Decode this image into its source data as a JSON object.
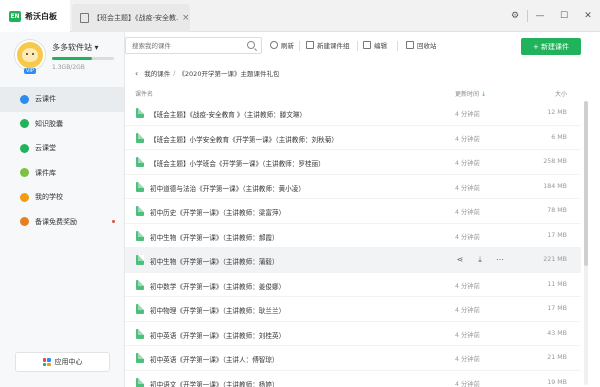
{
  "window": {
    "app_name": "希沃白板",
    "app_logo_text": "EN",
    "doc_tab_title": "【班会主题】《战疫-安全教...",
    "doc_tab_close": "×",
    "controls": [
      "⚙",
      "—",
      "☐",
      "✕"
    ]
  },
  "sidebar": {
    "user_name": "多多软件站 ▾",
    "vip_badge": "VIP",
    "storage_text": "1.3GB/2GB",
    "storage_fraction": 0.65,
    "items": [
      {
        "label": "云课件",
        "icon": "cloud-icon",
        "color": "#2d8cf0",
        "active": true
      },
      {
        "label": "知识胶囊",
        "icon": "capsule-icon",
        "color": "#21b35b",
        "active": false
      },
      {
        "label": "云课堂",
        "icon": "classroom-icon",
        "color": "#21b35b",
        "active": false
      },
      {
        "label": "课件库",
        "icon": "library-icon",
        "color": "#7cc142",
        "active": false
      },
      {
        "label": "我的学校",
        "icon": "school-icon",
        "color": "#f39c12",
        "active": false
      },
      {
        "label": "备课免费奖励",
        "icon": "gift-icon",
        "color": "#e67e22",
        "active": false
      }
    ],
    "app_center_label": "应用中心"
  },
  "toolbar": {
    "search_placeholder": "搜索我的课件",
    "refresh": "刷新",
    "new_group": "新建课件组",
    "edit": "编辑",
    "recycle": "回收站",
    "new_courseware": "+ 新建课件"
  },
  "breadcrumb": {
    "back": "‹",
    "root": "我的课件",
    "sep": "/",
    "current": "《2020开学第一课》主题课件礼包"
  },
  "table": {
    "col_name": "课件名",
    "col_time": "更新时间",
    "col_time_sort": "↓",
    "col_size": "大小",
    "rows": [
      {
        "name": "【班会主题】《战疫-安全教育 》（主讲教师：滕文琳）",
        "time": "4 分钟前",
        "size": "12 MB"
      },
      {
        "name": "【班会主题】小学安全教育《开学第一课》（主讲教师：刘秋菊）",
        "time": "4 分钟前",
        "size": "6 MB"
      },
      {
        "name": "【班会主题】小学班会《开学第一课》（主讲教师：罗桂丽）",
        "time": "4 分钟前",
        "size": "258 MB"
      },
      {
        "name": "初中道德与法治《开学第一课》（主讲教师：黄小凌）",
        "time": "4 分钟前",
        "size": "184 MB"
      },
      {
        "name": "初中历史《开学第一课》（主讲教师：梁富萍）",
        "time": "4 分钟前",
        "size": "78 MB"
      },
      {
        "name": "初中生物《开学第一课》（主讲教师：郝霞）",
        "time": "4 分钟前",
        "size": "17 MB"
      },
      {
        "name": "初中生物《开学第一课》（主讲教师：蒲毅）",
        "time": "",
        "size": "221 MB"
      },
      {
        "name": "初中数学《开学第一课》（主讲教师：姜俊娜）",
        "time": "4 分钟前",
        "size": "11 MB"
      },
      {
        "name": "初中物理《开学第一课》（主讲教师：耿兰兰）",
        "time": "4 分钟前",
        "size": "17 MB"
      },
      {
        "name": "初中英语《开学第一课》（主讲教师：刘桂英）",
        "time": "4 分钟前",
        "size": "43 MB"
      },
      {
        "name": "初中英语《开学第一课》（主讲人：傅智琼）",
        "time": "4 分钟前",
        "size": "21 MB"
      },
      {
        "name": "初中语文《开学第一课》（主讲教师：杨婷）",
        "time": "4 分钟前",
        "size": "19 MB"
      }
    ],
    "hover_actions": [
      "share-icon",
      "download-icon",
      "more-icon"
    ]
  }
}
